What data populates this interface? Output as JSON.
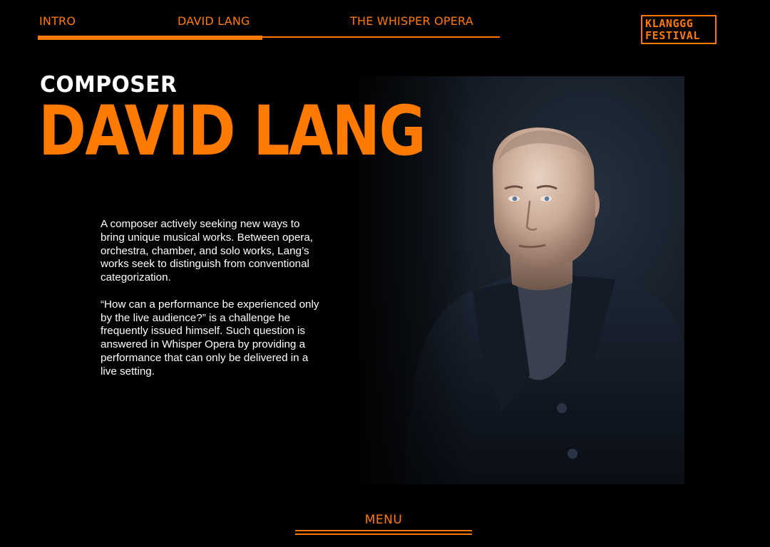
{
  "nav": {
    "tabs": [
      {
        "label": "INTRO"
      },
      {
        "label": "DAVID LANG",
        "active": true
      },
      {
        "label": "THE WHISPER OPERA"
      }
    ]
  },
  "logo": {
    "line1": "KLANGGG",
    "line2": "FESTIVAL"
  },
  "hero": {
    "kicker": "COMPOSER",
    "name": "DAVID LANG"
  },
  "bio": {
    "paragraph1": "A composer actively seeking new ways to bring unique musical works. Between opera, orchestra, chamber, and solo works, Lang’s works seek to distinguish from conventional categorization.",
    "paragraph2": "“How can a performance be experienced only by the live audience?” is a challenge he frequently issued himself. Such question is answered in Whisper Opera by providing a performance that can only be delivered in a live setting."
  },
  "menu": {
    "label": "MENU"
  },
  "colors": {
    "accent": "#ff7a00",
    "background": "#000000",
    "text": "#ffffff"
  }
}
